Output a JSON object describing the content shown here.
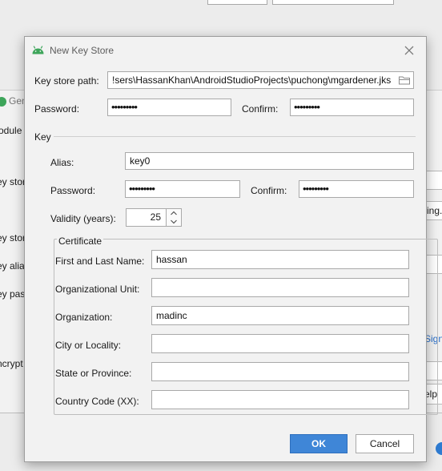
{
  "background": {
    "left_labels": [
      "Gen",
      "odule",
      "ey stor",
      "ey stor",
      "ey alia",
      "ey pas",
      "ncrypt"
    ],
    "right_labels": [
      "ing..."
    ],
    "link": "Sign",
    "help": "elp"
  },
  "dialog": {
    "title": "New Key Store",
    "keystore_path_label": "Key store path:",
    "keystore_path_value": "!sers\\HassanKhan\\AndroidStudioProjects\\puchong\\mgardener.jks",
    "password_label": "Password:",
    "password_value": "•••••••••",
    "confirm_label": "Confirm:",
    "confirm_value": "•••••••••",
    "key_section": "Key",
    "alias_label": "Alias:",
    "alias_value": "key0",
    "key_password_label": "Password:",
    "key_password_value": "•••••••••",
    "key_confirm_label": "Confirm:",
    "key_confirm_value": "•••••••••",
    "validity_label": "Validity (years):",
    "validity_value": "25",
    "certificate_legend": "Certificate",
    "first_last_label": "First and Last Name:",
    "first_last_value": "hassan",
    "org_unit_label": "Organizational Unit:",
    "org_unit_value": "",
    "organization_label": "Organization:",
    "organization_value": "madinc",
    "city_label": "City or Locality:",
    "city_value": "",
    "state_label": "State or Province:",
    "state_value": "",
    "country_label": "Country Code (XX):",
    "country_value": "",
    "ok_label": "OK",
    "cancel_label": "Cancel"
  },
  "icons": {
    "android": "android-icon",
    "close": "close-icon",
    "folder": "folder-icon",
    "spinner_up": "chevron-up-icon",
    "spinner_down": "chevron-down-icon"
  },
  "colors": {
    "accent": "#3f86d7",
    "android_green": "#3da55a",
    "link": "#2a6fc9"
  }
}
